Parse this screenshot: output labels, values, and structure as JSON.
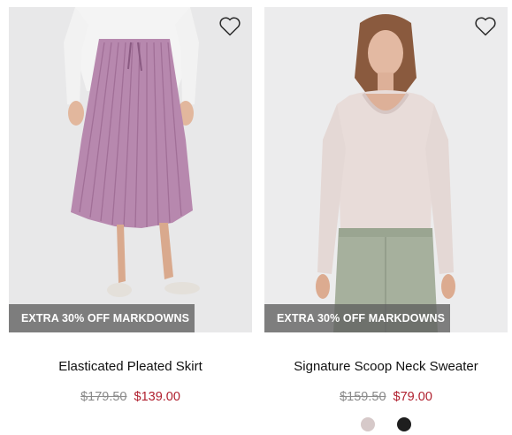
{
  "products": [
    {
      "name": "Elasticated Pleated Skirt",
      "badge": "EXTRA 30% OFF MARKDOWNS",
      "price_original": "$179.50",
      "price_sale": "$139.00",
      "wishlist_icon": "heart-outline-icon"
    },
    {
      "name": "Signature Scoop Neck Sweater",
      "badge": "EXTRA 30% OFF MARKDOWNS",
      "price_original": "$159.50",
      "price_sale": "$79.00",
      "wishlist_icon": "heart-outline-icon",
      "swatches": [
        {
          "color": "#d6c9c9"
        },
        {
          "color": "#1e1e1e"
        }
      ]
    }
  ],
  "colors": {
    "sale_price": "#b0202f",
    "original_price": "#8a8a8a",
    "badge_bg": "#5f5f5f"
  }
}
